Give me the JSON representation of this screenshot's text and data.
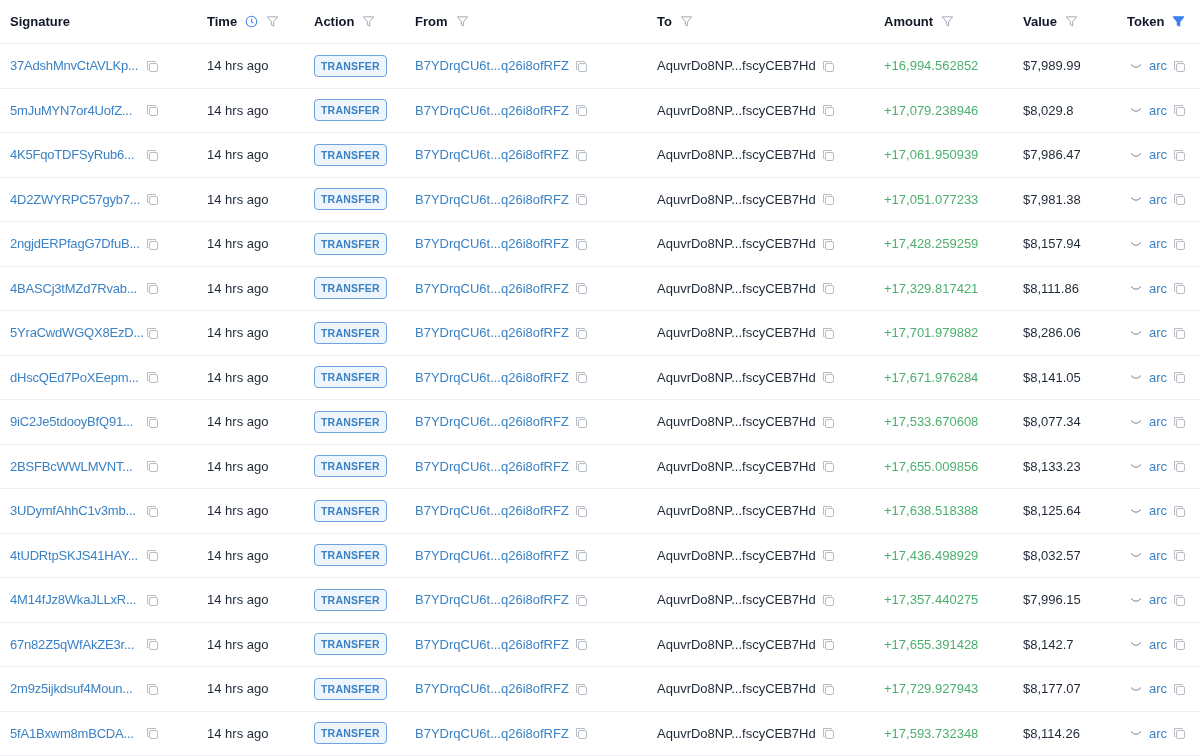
{
  "table": {
    "columns": [
      {
        "label": "Signature",
        "kind": "plain",
        "filter_active": false
      },
      {
        "label": "Time",
        "kind": "time",
        "filter_active": false
      },
      {
        "label": "Action",
        "kind": "filter",
        "filter_active": false
      },
      {
        "label": "From",
        "kind": "filter",
        "filter_active": false
      },
      {
        "label": "To",
        "kind": "filter",
        "filter_active": false
      },
      {
        "label": "Amount",
        "kind": "filter",
        "filter_active": false
      },
      {
        "label": "Value",
        "kind": "filter",
        "filter_active": false
      },
      {
        "label": "Token",
        "kind": "filter",
        "filter_active": true
      }
    ],
    "rows": [
      {
        "signature": "37AdshMnvCtAVLKp...",
        "time": "14 hrs ago",
        "action": "TRANSFER",
        "from": "B7YDrqCU6t...q26i8ofRFZ",
        "to": "AquvrDo8NP...fscyCEB7Hd",
        "amount": "+16,994.562852",
        "value": "$7,989.99",
        "token": "arc"
      },
      {
        "signature": "5mJuMYN7or4UofZ...",
        "time": "14 hrs ago",
        "action": "TRANSFER",
        "from": "B7YDrqCU6t...q26i8ofRFZ",
        "to": "AquvrDo8NP...fscyCEB7Hd",
        "amount": "+17,079.238946",
        "value": "$8,029.8",
        "token": "arc"
      },
      {
        "signature": "4K5FqoTDFSyRub6...",
        "time": "14 hrs ago",
        "action": "TRANSFER",
        "from": "B7YDrqCU6t...q26i8ofRFZ",
        "to": "AquvrDo8NP...fscyCEB7Hd",
        "amount": "+17,061.950939",
        "value": "$7,986.47",
        "token": "arc"
      },
      {
        "signature": "4D2ZWYRPC57gyb7...",
        "time": "14 hrs ago",
        "action": "TRANSFER",
        "from": "B7YDrqCU6t...q26i8ofRFZ",
        "to": "AquvrDo8NP...fscyCEB7Hd",
        "amount": "+17,051.077233",
        "value": "$7,981.38",
        "token": "arc"
      },
      {
        "signature": "2ngjdERPfagG7DfuB...",
        "time": "14 hrs ago",
        "action": "TRANSFER",
        "from": "B7YDrqCU6t...q26i8ofRFZ",
        "to": "AquvrDo8NP...fscyCEB7Hd",
        "amount": "+17,428.259259",
        "value": "$8,157.94",
        "token": "arc"
      },
      {
        "signature": "4BASCj3tMZd7Rvab...",
        "time": "14 hrs ago",
        "action": "TRANSFER",
        "from": "B7YDrqCU6t...q26i8ofRFZ",
        "to": "AquvrDo8NP...fscyCEB7Hd",
        "amount": "+17,329.817421",
        "value": "$8,111.86",
        "token": "arc"
      },
      {
        "signature": "5YraCwdWGQX8EzD...",
        "time": "14 hrs ago",
        "action": "TRANSFER",
        "from": "B7YDrqCU6t...q26i8ofRFZ",
        "to": "AquvrDo8NP...fscyCEB7Hd",
        "amount": "+17,701.979882",
        "value": "$8,286.06",
        "token": "arc"
      },
      {
        "signature": "dHscQEd7PoXEepm...",
        "time": "14 hrs ago",
        "action": "TRANSFER",
        "from": "B7YDrqCU6t...q26i8ofRFZ",
        "to": "AquvrDo8NP...fscyCEB7Hd",
        "amount": "+17,671.976284",
        "value": "$8,141.05",
        "token": "arc"
      },
      {
        "signature": "9iC2Je5tdooyBfQ91...",
        "time": "14 hrs ago",
        "action": "TRANSFER",
        "from": "B7YDrqCU6t...q26i8ofRFZ",
        "to": "AquvrDo8NP...fscyCEB7Hd",
        "amount": "+17,533.670608",
        "value": "$8,077.34",
        "token": "arc"
      },
      {
        "signature": "2BSFBcWWLMVNT...",
        "time": "14 hrs ago",
        "action": "TRANSFER",
        "from": "B7YDrqCU6t...q26i8ofRFZ",
        "to": "AquvrDo8NP...fscyCEB7Hd",
        "amount": "+17,655.009856",
        "value": "$8,133.23",
        "token": "arc"
      },
      {
        "signature": "3UDymfAhhC1v3mb...",
        "time": "14 hrs ago",
        "action": "TRANSFER",
        "from": "B7YDrqCU6t...q26i8ofRFZ",
        "to": "AquvrDo8NP...fscyCEB7Hd",
        "amount": "+17,638.518388",
        "value": "$8,125.64",
        "token": "arc"
      },
      {
        "signature": "4tUDRtpSKJS41HAY...",
        "time": "14 hrs ago",
        "action": "TRANSFER",
        "from": "B7YDrqCU6t...q26i8ofRFZ",
        "to": "AquvrDo8NP...fscyCEB7Hd",
        "amount": "+17,436.498929",
        "value": "$8,032.57",
        "token": "arc"
      },
      {
        "signature": "4M14fJz8WkaJLLxR...",
        "time": "14 hrs ago",
        "action": "TRANSFER",
        "from": "B7YDrqCU6t...q26i8ofRFZ",
        "to": "AquvrDo8NP...fscyCEB7Hd",
        "amount": "+17,357.440275",
        "value": "$7,996.15",
        "token": "arc"
      },
      {
        "signature": "67n82Z5qWfAkZE3r...",
        "time": "14 hrs ago",
        "action": "TRANSFER",
        "from": "B7YDrqCU6t...q26i8ofRFZ",
        "to": "AquvrDo8NP...fscyCEB7Hd",
        "amount": "+17,655.391428",
        "value": "$8,142.7",
        "token": "arc"
      },
      {
        "signature": "2m9z5ijkdsuf4Moun...",
        "time": "14 hrs ago",
        "action": "TRANSFER",
        "from": "B7YDrqCU6t...q26i8ofRFZ",
        "to": "AquvrDo8NP...fscyCEB7Hd",
        "amount": "+17,729.927943",
        "value": "$8,177.07",
        "token": "arc"
      },
      {
        "signature": "5fA1Bxwm8mBCDA...",
        "time": "14 hrs ago",
        "action": "TRANSFER",
        "from": "B7YDrqCU6t...q26i8ofRFZ",
        "to": "AquvrDo8NP...fscyCEB7Hd",
        "amount": "+17,593.732348",
        "value": "$8,114.26",
        "token": "arc"
      }
    ]
  }
}
